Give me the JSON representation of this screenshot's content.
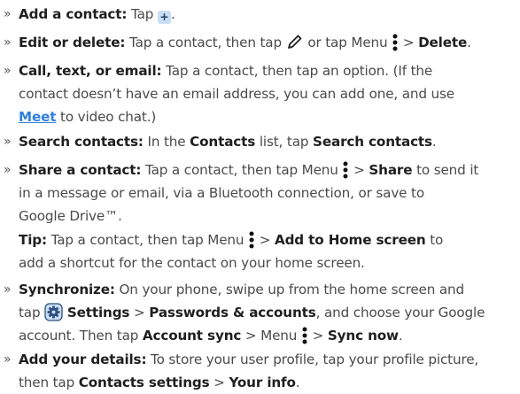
{
  "bullet_glyph": "»",
  "items": {
    "add_contact": {
      "label": "Add a contact:",
      "t1": " Tap ",
      "t2": "."
    },
    "edit_delete": {
      "label": "Edit or delete:",
      "t1": " Tap a contact, then tap ",
      "t2": " or tap Menu ",
      "t3": " > ",
      "b1": "Delete",
      "t4": "."
    },
    "call_text_email": {
      "label": "Call, text, or email:",
      "l1": " Tap a contact, then tap an option. (If the",
      "l2": "contact doesn’t have an email address, you can add one, and use",
      "link": "Meet",
      "l3": " to video chat.)"
    },
    "search": {
      "label": "Search contacts:",
      "t1": " In the ",
      "b1": "Contacts",
      "t2": " list, tap ",
      "b2": "Search contacts",
      "t3": "."
    },
    "share": {
      "label": "Share a contact:",
      "t1": " Tap a contact, then tap Menu ",
      "t2": " > ",
      "b1": "Share",
      "t3": " to send it",
      "l2": "in a message or email, via a Bluetooth connection, or save to",
      "l3": "Google Drive™."
    },
    "tip": {
      "label": "Tip:",
      "t1": " Tap a contact, then tap Menu ",
      "t2": " > ",
      "b1": "Add to Home screen",
      "t3": " to",
      "l2": "add a shortcut for the contact on your home screen."
    },
    "sync": {
      "label": "Synchronize:",
      "t1": " On your phone, swipe up from the home screen and",
      "l2a": "tap ",
      "b1": "Settings",
      "l2b": " > ",
      "b2": "Passwords & accounts",
      "l2c": ", and choose your Google",
      "l3a": "account. Then tap ",
      "b3": "Account sync",
      "l3b": " > Menu ",
      "l3c": " > ",
      "b4": "Sync now",
      "l3d": "."
    },
    "your_details": {
      "label": "Add your details:",
      "t1": " To store your user profile, tap your profile picture,",
      "l2a": "then tap ",
      "b1": "Contacts settings",
      "l2b": " > ",
      "b2": "Your info",
      "l2c": "."
    }
  },
  "icons": {
    "plus": "plus-icon",
    "plus_glyph": "+",
    "pencil": "pencil-icon",
    "menu": "more-vertical-icon",
    "settings": "settings-gear-icon"
  },
  "colors": {
    "link": "#2f7fdc",
    "icon_bg": "#c9def4",
    "text": "#4a4a4a",
    "bold": "#1f1f1f"
  }
}
